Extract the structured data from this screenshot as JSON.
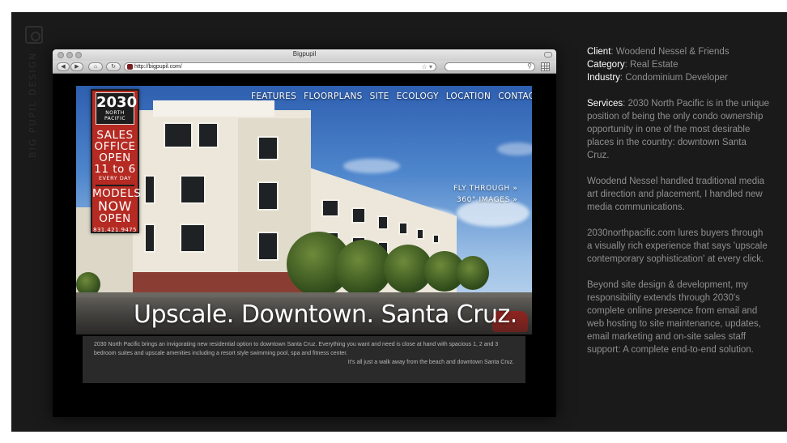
{
  "window": {
    "title": "Bigpupil",
    "url": "http://bigpupil.com/"
  },
  "sidebar_watermark": {
    "text": "BIG PUPIL DESIGN",
    "icon": "logo-icon"
  },
  "site": {
    "nav": [
      "FEATURES",
      "FLOORPLANS",
      "SITE",
      "ECOLOGY",
      "LOCATION",
      "CONTACT"
    ],
    "logo": {
      "year": "2030",
      "line1": "NORTH",
      "line2": "PACIFIC"
    },
    "promo": {
      "l1": "SALES",
      "l2": "OFFICE",
      "l3": "OPEN",
      "l4": "11 to 6",
      "l5": "EVERY DAY",
      "l6": "MODELS",
      "l7": "NOW",
      "l8": "OPEN",
      "phone": "831.421.9475"
    },
    "fly_through": {
      "line1": "FLY THROUGH »",
      "line2": "360° IMAGES »"
    },
    "tagline": "Upscale. Downtown. Santa Cruz.",
    "description": "2030 North Pacific brings an invigorating new residential option to downtown Santa Cruz. Everything you want and need is close at hand with spacious 1, 2 and 3 bedroom suites and upscale amenities including a resort style swimming pool, spa and fitness center.",
    "description2": "It's all just a walk away from the beach and downtown Santa Cruz."
  },
  "info": {
    "client_label": "Client",
    "client": ": Woodend Nessel & Friends",
    "category_label": "Category",
    "category": ": Real Estate",
    "industry_label": "Industry",
    "industry": ": Condominium Developer",
    "services_label": "Services",
    "services": ": 2030 North Pacific is in the unique position of being the only condo ownership opportunity in one of the most desirable places in the country: downtown Santa Cruz.",
    "p2": "Woodend Nessel handled traditional media art direction and placement, I handled new media communications.",
    "p3": "2030northpacific.com lures buyers through a visually rich experience that says 'upscale contemporary sophistication' at every click.",
    "p4": "Beyond site design & development, my responsibility extends through 2030's complete online presence from email and web hosting to site maintenance, updates, email marketing and on-site sales staff support: A complete end-to-end solution."
  },
  "colors": {
    "frame_bg": "#1a1a1a",
    "promo_red": "#b52a22",
    "label_white": "#ffffff",
    "text_gray": "#8f8f8f"
  }
}
